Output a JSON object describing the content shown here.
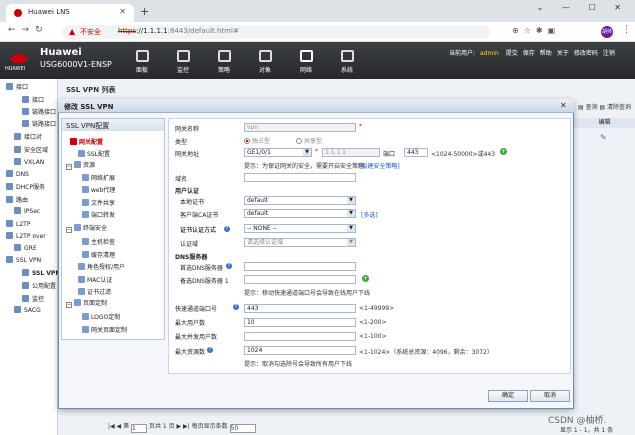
{
  "browser": {
    "tab_title": "Huawei LNS",
    "tab_close": "✕",
    "new_tab": "+",
    "window_controls": "⌄ — ☐ ✕",
    "nav": "←→↻",
    "not_secure": "不安全",
    "url_scheme": "https",
    "url_rest": "://1.1.1.1",
    "url_path": ":8443/default.html#",
    "extensions": "⊕☆✱▣",
    "profile": "胡帅",
    "menu": "⋮"
  },
  "app": {
    "logo_text": "HUAWEI",
    "brand": "Huawei",
    "model": "USG6000V1-ENSP",
    "nav": [
      {
        "label": "面板"
      },
      {
        "label": "监控"
      },
      {
        "label": "策略"
      },
      {
        "label": "对象"
      },
      {
        "label": "网络"
      },
      {
        "label": "系统"
      }
    ],
    "user_prefix": "当前用户:",
    "user": "admin",
    "user_links": [
      "提交",
      "保存",
      "帮助",
      "关于",
      "修改密码",
      "注销"
    ]
  },
  "tree": [
    {
      "label": "接口"
    },
    {
      "label": "接口"
    },
    {
      "label": "链路接口"
    },
    {
      "label": "链路接口"
    },
    {
      "label": "接口对"
    },
    {
      "label": "安全区域"
    },
    {
      "label": "VXLAN"
    },
    {
      "label": "DNS"
    },
    {
      "label": "DHCP服务"
    },
    {
      "label": "路由"
    },
    {
      "label": "IPSec"
    },
    {
      "label": "L2TP"
    },
    {
      "label": "L2TP over"
    },
    {
      "label": "GRE"
    },
    {
      "label": "SSL VPN"
    },
    {
      "label": "SSL VPN"
    },
    {
      "label": "公用配置"
    },
    {
      "label": "监控"
    },
    {
      "label": "SACG"
    }
  ],
  "main": {
    "title": "SSL VPN 列表",
    "tools": "▤ 查询  ▤ 清除查询",
    "col_edit": "编辑",
    "pager": {
      "page_label": "第",
      "page_value": "1",
      "total": "页共 1 页",
      "per_page_label": "每页显示条数",
      "per_page": "50"
    },
    "footer": "显示 1 - 1，共 1 条",
    "watermark": "CSDN @柚桥."
  },
  "dialog": {
    "title": "修改 SSL VPN",
    "close": "✕",
    "nav_header": "SSL VPN配置",
    "nav": [
      {
        "label": "网关配置"
      },
      {
        "label": "SSL配置"
      },
      {
        "label": "资源"
      },
      {
        "label": "网络扩展"
      },
      {
        "label": "web代理"
      },
      {
        "label": "文件共享"
      },
      {
        "label": "端口转发"
      },
      {
        "label": "终端安全"
      },
      {
        "label": "主机检查"
      },
      {
        "label": "缓存清理"
      },
      {
        "label": "角色授权/用户"
      },
      {
        "label": "MAC认证"
      },
      {
        "label": "证书过滤"
      },
      {
        "label": "页面定制"
      },
      {
        "label": "LOGO定制"
      },
      {
        "label": "网关页面定制"
      }
    ],
    "form": {
      "gw_name_label": "网关名称",
      "gw_name_value": "vpn",
      "type_label": "类型",
      "type_opt1": "独占型",
      "type_opt2": "共享型",
      "addr_label": "网关地址",
      "iface_value": "GE1/0/1",
      "ip_value": "1.1.1.1",
      "port_label": "端口",
      "port_value": "443",
      "port_hint": "<1024-50000>或443",
      "addr_hint": "提示：为保证网关的安全，需要开启安全策略。",
      "new_policy_link": "[新建安全策略]",
      "domain_label": "域名",
      "user_auth_section": "用户认证",
      "local_cert_label": "本地证书",
      "local_cert_value": "default",
      "ca_cert_label": "客户端CA证书",
      "ca_cert_value": "default",
      "more_link": "[多选]",
      "cert_auth_label": "证书认证方式",
      "cert_auth_value": "-- NONE --",
      "auth_domain_label": "认证域",
      "auth_domain_value": "请选择认证域",
      "dns_section": "DNS服务器",
      "dns1_label": "首选DNS服务器",
      "dns2_label": "备选DNS服务器 1",
      "dns_hint": "提示：移动快速通道端口号会导致在线用户下线",
      "fast_port_label": "快速通道端口号",
      "fast_port_value": "443",
      "fast_port_range": "<1-49999>",
      "max_users_label": "最大用户数",
      "max_users_value": "10",
      "max_users_range": "<1-200>",
      "max_concurrent_label": "最大并发用户数",
      "max_concurrent_range": "<1-100>",
      "max_res_label": "最大资源数",
      "max_res_value": "1024",
      "max_res_range": "<1-1024>（系统总资源：4096，剩余：3072）",
      "bottom_hint": "提示：取消勾选除号会导致所有用户下线"
    },
    "ok": "确定",
    "cancel": "取消"
  }
}
